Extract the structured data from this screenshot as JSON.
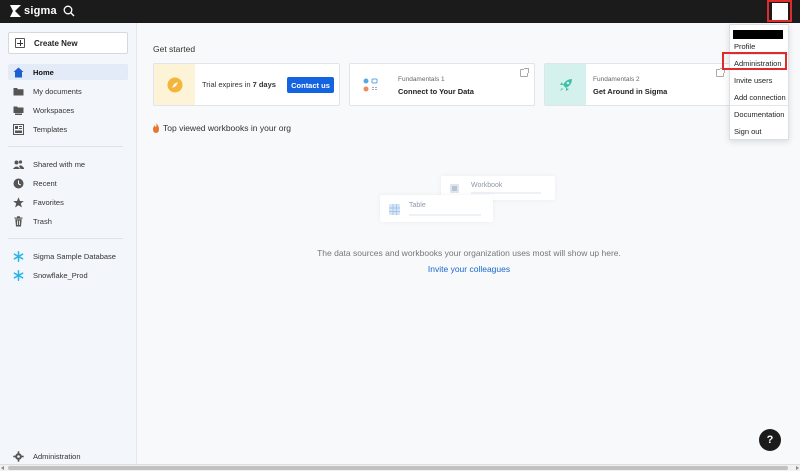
{
  "app": {
    "logo_text": "sigma"
  },
  "sidebar": {
    "create_label": "Create New",
    "items": [
      {
        "label": "Home",
        "icon": "home-icon",
        "active": true
      },
      {
        "label": "My documents",
        "icon": "folder-icon"
      },
      {
        "label": "Workspaces",
        "icon": "workspaces-icon"
      },
      {
        "label": "Templates",
        "icon": "templates-icon"
      },
      {
        "label": "Shared with me",
        "icon": "people-icon"
      },
      {
        "label": "Recent",
        "icon": "clock-icon"
      },
      {
        "label": "Favorites",
        "icon": "star-icon"
      },
      {
        "label": "Trash",
        "icon": "trash-icon"
      },
      {
        "label": "Sigma Sample Database",
        "icon": "snowflake-icon"
      },
      {
        "label": "Snowflake_Prod",
        "icon": "snowflake-icon"
      }
    ],
    "admin_label": "Administration"
  },
  "main": {
    "get_started": "Get started",
    "trial": {
      "prefix": "Trial expires in ",
      "days": "7 days",
      "contact": "Contact us"
    },
    "cards": [
      {
        "small": "Fundamentals 1",
        "big": "Connect to Your Data"
      },
      {
        "small": "Fundamentals 2",
        "big": "Get Around in Sigma"
      }
    ],
    "top_viewed": "Top viewed workbooks in your org",
    "illustration": {
      "workbook": "Workbook",
      "table": "Table"
    },
    "empty_message": "The data sources and workbooks your organization uses most will show up here.",
    "invite_link": "Invite your colleagues"
  },
  "dropdown": {
    "items": [
      "Profile",
      "Administration",
      "Invite users",
      "Add connection",
      "Documentation",
      "Sign out"
    ]
  },
  "help": {
    "label": "?"
  },
  "colors": {
    "accent": "#1463e0",
    "highlight": "#e02b2b",
    "topbar": "#1b1b1b"
  }
}
